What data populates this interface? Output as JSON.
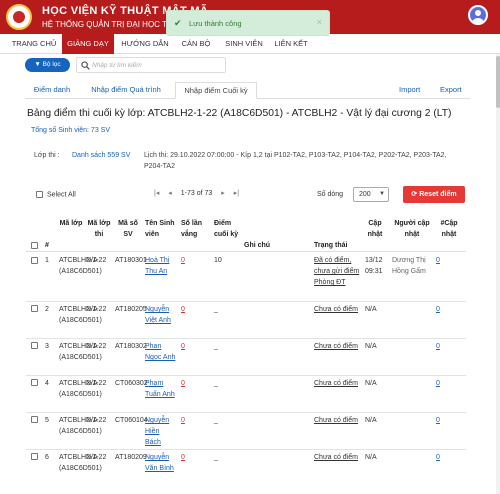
{
  "header": {
    "title": "HỌC VIỆN KỸ THUẬT MẬT MÃ",
    "subtitle": "HỆ THỐNG QUẢN TRỊ ĐẠI HỌC TRỰC TUYẾN"
  },
  "nav": {
    "items": [
      {
        "label": "TRANG CHỦ",
        "active": false
      },
      {
        "label": "GIẢNG DẠY",
        "active": true
      },
      {
        "label": "HƯỚNG DẪN",
        "active": false
      },
      {
        "label": "CÁN BỘ",
        "active": false
      },
      {
        "label": "SINH VIÊN",
        "active": false
      },
      {
        "label": "LIÊN KẾT",
        "active": false
      }
    ]
  },
  "toast": {
    "message": "Lưu thành công",
    "close": "×"
  },
  "filter": {
    "button_label": "Bộ lọc",
    "search_placeholder": "Nhập từ tìm kiếm"
  },
  "tabs": {
    "items": [
      "Điểm danh",
      "Nhập điểm Quá trình",
      "Nhập điểm Cuối kỳ"
    ],
    "active_index": 2,
    "import_label": "Import",
    "export_label": "Export"
  },
  "page": {
    "title": "Bảng điểm thi cuối kỳ lớp: ATCBLH2-1-22 (A18C6D501) - ATCBLH2 - Vật lý đại cương 2 (LT)",
    "student_total": "Tổng số Sinh viên: 73 SV",
    "info_label": "Lớp thi :",
    "info_link": "Danh sách 559 SV",
    "schedule": "Lịch thi: 29.10.2022 07:00:00 - Kíp 1,2 tại P102-TA2, P103-TA2, P104-TA2, P202-TA2, P203-TA2, P204-TA2"
  },
  "toolbar": {
    "select_all": "Select All",
    "first_icon": "|◂",
    "prev_icon": "◂",
    "range": "1-73 of 73",
    "next_icon": "▸",
    "last_icon": "▸|",
    "rows_label": "Số dòng",
    "rows_value": "200",
    "reset_label": "Reset điểm"
  },
  "table": {
    "headers": {
      "index": "#",
      "class_code": "Mã lớp",
      "exam_class": "Mã lớp thi",
      "student_id": "Mã số SV",
      "student_name": "Tên Sinh viên",
      "edits": "Số lần vắng",
      "final_score": "Điểm cuối kỳ",
      "note": "Ghi chú",
      "status": "Trạng thái",
      "updated": "Cập nhật",
      "updated_by": "Người cập nhật",
      "update_count": "#Cập nhật"
    },
    "rows": [
      {
        "index": "1",
        "class_code": "ATCBLH2-1-22 (A18C6D501)",
        "exam_class": "N/A",
        "student_id": "AT180301",
        "student_name": "Hoà Thị Thu An",
        "edits": "0",
        "final_score": "10",
        "note": "",
        "status": "Đã có điểm, chưa gửi điểm Phòng ĐT",
        "updated": "13/12 09:31",
        "updated_by": "Dương Thị Hồng Gấm",
        "update_count": "0"
      },
      {
        "index": "2",
        "class_code": "ATCBLH2-1-22 (A18C6D501)",
        "exam_class": "N/A",
        "student_id": "AT180205",
        "student_name": "Nguyễn Việt Anh",
        "edits": "0",
        "final_score": "_",
        "note": "",
        "status": "Chưa có điểm",
        "updated": "N/A",
        "updated_by": "",
        "update_count": "0"
      },
      {
        "index": "3",
        "class_code": "ATCBLH2-1-22 (A18C6D501)",
        "exam_class": "N/A",
        "student_id": "AT180302",
        "student_name": "Phan Ngọc Anh",
        "edits": "0",
        "final_score": "_",
        "note": "",
        "status": "Chưa có điểm",
        "updated": "N/A",
        "updated_by": "",
        "update_count": "0"
      },
      {
        "index": "4",
        "class_code": "ATCBLH2-1-22 (A18C6D501)",
        "exam_class": "N/A",
        "student_id": "CT060302",
        "student_name": "Phạm Tuấn Anh",
        "edits": "0",
        "final_score": "_",
        "note": "",
        "status": "Chưa có điểm",
        "updated": "N/A",
        "updated_by": "",
        "update_count": "0"
      },
      {
        "index": "5",
        "class_code": "ATCBLH2-1-22 (A18C6D501)",
        "exam_class": "N/A",
        "student_id": "CT060104",
        "student_name": "Nguyễn Hiền Bách",
        "edits": "0",
        "final_score": "_",
        "note": "",
        "status": "Chưa có điểm",
        "updated": "N/A",
        "updated_by": "",
        "update_count": "0"
      },
      {
        "index": "6",
        "class_code": "ATCBLH2-1-22 (A18C6D501)",
        "exam_class": "N/A",
        "student_id": "AT180209",
        "student_name": "Nguyễn Văn Bình",
        "edits": "0",
        "final_score": "_",
        "note": "",
        "status": "Chưa có điểm",
        "updated": "N/A",
        "updated_by": "",
        "update_count": "0"
      }
    ]
  },
  "colors": {
    "brand": "#b71c1c",
    "link": "#1a5fb4",
    "danger": "#e53935",
    "success_bg": "#d4edda"
  }
}
